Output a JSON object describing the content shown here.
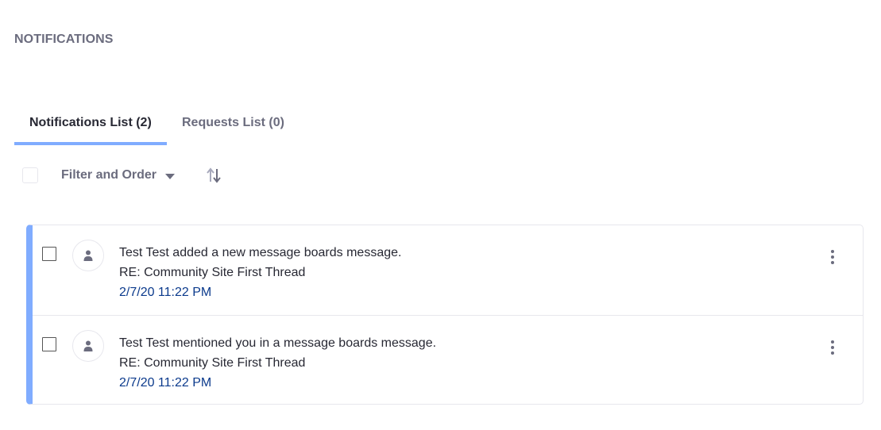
{
  "header": {
    "title": "NOTIFICATIONS"
  },
  "tabs": [
    {
      "label": "Notifications List (2)",
      "active": true
    },
    {
      "label": "Requests List (0)",
      "active": false
    }
  ],
  "toolbar": {
    "filter_label": "Filter and Order",
    "filter_icon": "caret-down-icon",
    "sort_icon": "order-arrows-icon"
  },
  "colors": {
    "accent": "#80acff",
    "link": "#0b3a8c",
    "secondary_text": "#6b6c7e",
    "primary_text": "#272833"
  },
  "notifications": [
    {
      "title": "Test Test added a new message boards message.",
      "subtitle": "RE: Community Site First Thread",
      "timestamp": "2/7/20 11:22 PM",
      "avatar_icon": "user-icon",
      "actions_icon": "ellipsis-v-icon"
    },
    {
      "title": "Test Test mentioned you in a message boards message.",
      "subtitle": "RE: Community Site First Thread",
      "timestamp": "2/7/20 11:22 PM",
      "avatar_icon": "user-icon",
      "actions_icon": "ellipsis-v-icon"
    }
  ]
}
